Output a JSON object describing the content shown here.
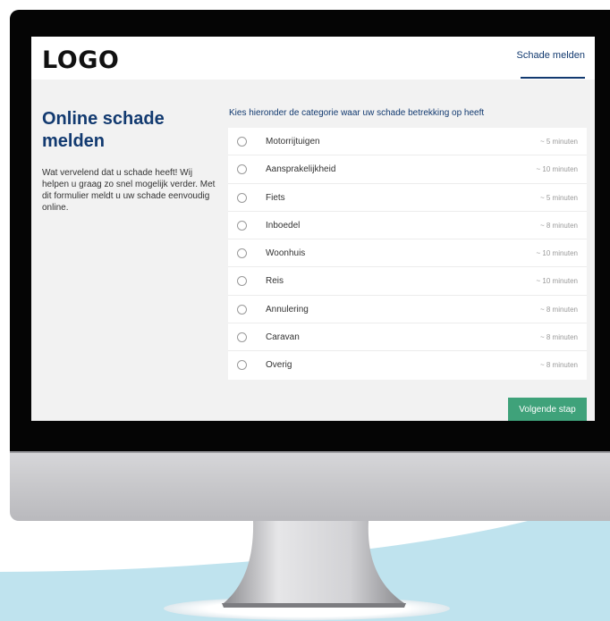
{
  "site": {
    "logo_text": "LOGO",
    "nav_link": "Schade melden"
  },
  "sidebar": {
    "title": "Online schade melden",
    "intro": "Wat vervelend dat u schade heeft! Wij helpen u graag zo snel mogelijk verder. Met dit formulier meldt u uw schade eenvoudig online."
  },
  "form": {
    "question": "Kies hieronder de categorie waar uw schade betrekking op heeft",
    "options": [
      {
        "label": "Motorrijtuigen",
        "time": "~ 5 minuten"
      },
      {
        "label": "Aansprakelijkheid",
        "time": "~ 10 minuten"
      },
      {
        "label": "Fiets",
        "time": "~ 5 minuten"
      },
      {
        "label": "Inboedel",
        "time": "~ 8 minuten"
      },
      {
        "label": "Woonhuis",
        "time": "~ 10 minuten"
      },
      {
        "label": "Reis",
        "time": "~ 10 minuten"
      },
      {
        "label": "Annulering",
        "time": "~ 8 minuten"
      },
      {
        "label": "Caravan",
        "time": "~ 8 minuten"
      },
      {
        "label": "Overig",
        "time": "~ 8 minuten"
      }
    ],
    "next_button": "Volgende stap"
  },
  "colors": {
    "brand_navy": "#123a70",
    "accent_green": "#3fa27a",
    "background_wave": "#bfe3ee"
  }
}
